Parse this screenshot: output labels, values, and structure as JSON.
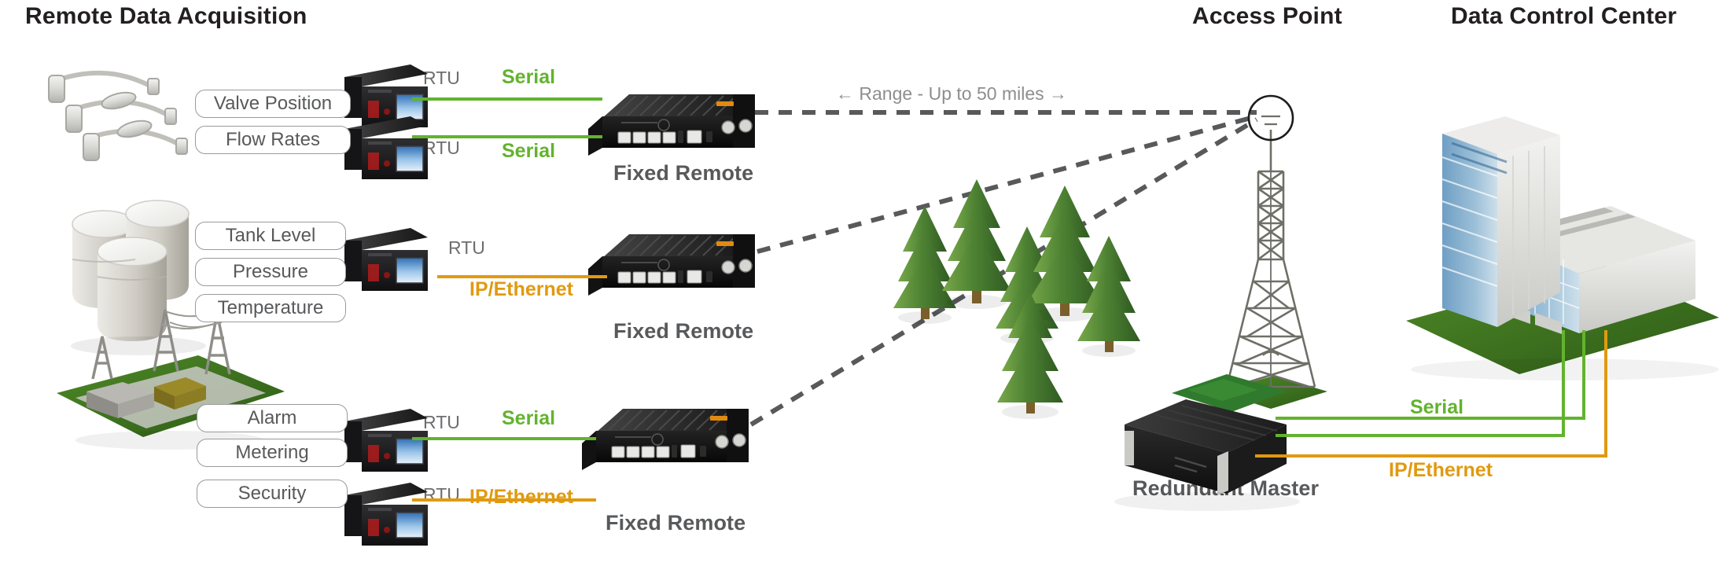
{
  "headings": {
    "remote": "Remote Data Acquisition",
    "access_point": "Access Point",
    "control_center": "Data Control Center"
  },
  "colors": {
    "serial": "#62b32e",
    "ethernet": "#e09a10",
    "heading": "#231f20",
    "caption": "#58595b",
    "dashed_link": "#58595b",
    "pill_border": "#9a9a9a"
  },
  "range_note": "←  Range - Up to 50 miles →",
  "groups": [
    {
      "id": "valve-flow",
      "source_icon": "pressure-sensor-icon",
      "pills": [
        "Valve Position",
        "Flow Rates"
      ],
      "rtus": [
        {
          "tag": "RTU",
          "link": "Serial",
          "link_type": "serial"
        },
        {
          "tag": "RTU",
          "link": "Serial",
          "link_type": "serial"
        }
      ],
      "remote_caption": "Fixed Remote"
    },
    {
      "id": "tank",
      "source_icon": "storage-tanks-icon",
      "pills": [
        "Tank Level",
        "Pressure",
        "Temperature"
      ],
      "rtus": [
        {
          "tag": "RTU",
          "link": "IP/Ethernet",
          "link_type": "ethernet"
        }
      ],
      "remote_caption": "Fixed Remote"
    },
    {
      "id": "substation",
      "source_icon": "substation-icon",
      "pills": [
        "Alarm",
        "Metering",
        "Security"
      ],
      "rtus": [
        {
          "tag": "RTU",
          "link": "Serial",
          "link_type": "serial"
        },
        {
          "tag": "RTU",
          "link": "IP/Ethernet",
          "link_type": "ethernet"
        }
      ],
      "remote_caption": "Fixed Remote"
    }
  ],
  "access_point": {
    "icon": "radio-tower-icon",
    "antenna_icon": "antenna-circle-icon"
  },
  "master": {
    "caption": "Redundant  Master",
    "icon": "rack-server-icon"
  },
  "backhaul": {
    "serial_label": "Serial",
    "ethernet_label": "IP/Ethernet"
  },
  "control_center": {
    "icon": "office-building-icon"
  },
  "scenery": {
    "trees_icon": "pine-trees-icon",
    "tree_count": 6
  }
}
